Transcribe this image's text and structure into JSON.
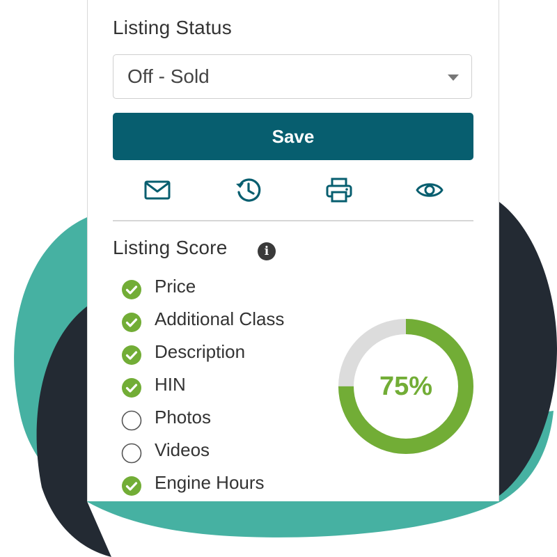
{
  "listing_status": {
    "title": "Listing Status",
    "selected": "Off - Sold"
  },
  "save_label": "Save",
  "actions": [
    {
      "icon": "mail-icon"
    },
    {
      "icon": "history-icon"
    },
    {
      "icon": "print-icon"
    },
    {
      "icon": "eye-icon"
    }
  ],
  "listing_score": {
    "title": "Listing Score",
    "info_icon": "i",
    "items": [
      {
        "label": "Price",
        "checked": true
      },
      {
        "label": "Additional Class",
        "checked": true
      },
      {
        "label": "Description",
        "checked": true
      },
      {
        "label": "HIN",
        "checked": true
      },
      {
        "label": "Photos",
        "checked": false
      },
      {
        "label": "Videos",
        "checked": false
      },
      {
        "label": "Engine Hours",
        "checked": true
      }
    ],
    "percent_label": "75%",
    "percent_value": 0.75
  },
  "colors": {
    "accent": "#075e6f",
    "green": "#72ad36",
    "track": "#dcdcdc",
    "teal": "#46b1a2",
    "navy": "#232a33"
  }
}
